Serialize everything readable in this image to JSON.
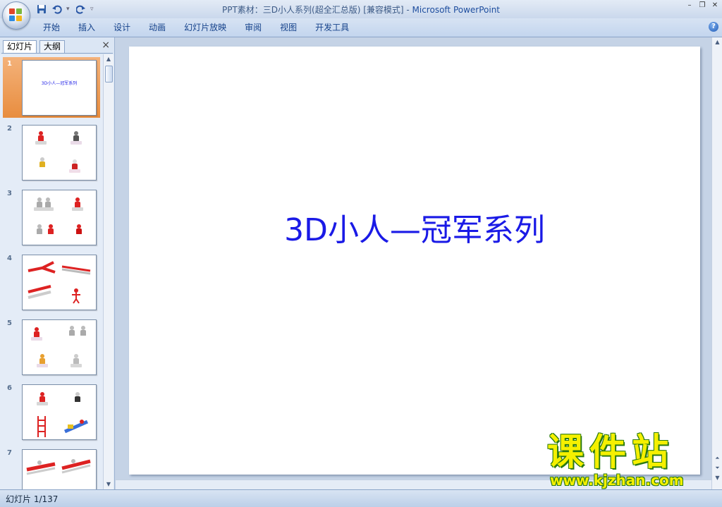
{
  "window": {
    "title": "PPT素材：三D小人系列(超全汇总版) [兼容模式] - ",
    "app": "Microsoft PowerPoint"
  },
  "ribbon": {
    "tabs": [
      "开始",
      "插入",
      "设计",
      "动画",
      "幻灯片放映",
      "审阅",
      "视图",
      "开发工具"
    ]
  },
  "slides_pane": {
    "tabs": [
      "幻灯片",
      "大纲"
    ],
    "close_label": "×",
    "slides": [
      {
        "number": "1",
        "title": "3D小人—冠军系列"
      },
      {
        "number": "2"
      },
      {
        "number": "3"
      },
      {
        "number": "4"
      },
      {
        "number": "5"
      },
      {
        "number": "6"
      },
      {
        "number": "7"
      }
    ]
  },
  "slide": {
    "title": "3D小人—冠军系列"
  },
  "status": {
    "slide_info": "幻灯片 1/137"
  },
  "watermark": {
    "cn": "课件站",
    "url": "www.kjzhan.com"
  },
  "colors": {
    "accent": "#1a1ae6",
    "selected_slide": "#e88d3f",
    "ribbon_text": "#15428b"
  }
}
